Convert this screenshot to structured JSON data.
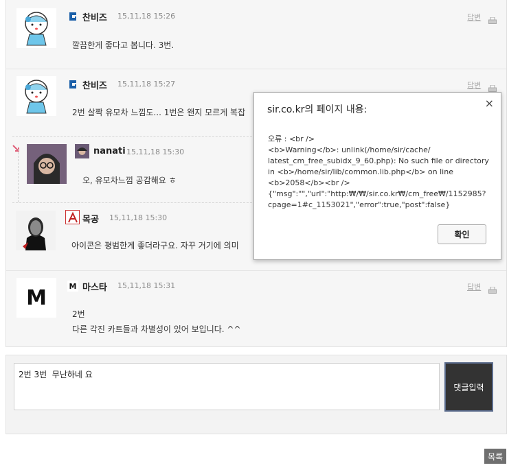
{
  "comments": [
    {
      "nick": "찬비즈",
      "date": "15,11,18 15:26",
      "reply_label": "답변",
      "lines": [
        "깔끔한게 좋다고 봅니다. 3번."
      ]
    },
    {
      "nick": "찬비즈",
      "date": "15,11,18 15:27",
      "reply_label": "답변",
      "lines": [
        "2번 살짝 유모차 느낌도... 1번은 왠지 모르게 복잡"
      ]
    },
    {
      "nick": "nanati",
      "date": "15,11,18 15:30",
      "lines": [
        "오, 유모차느낌 공감해요 ㅎ"
      ]
    },
    {
      "nick": "목공",
      "date": "15,11,18 15:30",
      "lines": [
        "아이콘은 평범한게 좋더라구요. 자꾸 거기에 의미"
      ]
    },
    {
      "nick": "마스타",
      "date": "15,11,18 15:31",
      "reply_label": "답변",
      "avatar_letter": "M",
      "level_letter": "M",
      "lines": [
        "2번",
        "다른 각진 카트들과 차별성이 있어 보입니다. ^^"
      ]
    }
  ],
  "compose": {
    "value": "2번 3번  무난하네 요",
    "submit_label": "댓글입력"
  },
  "list_button": "목록",
  "dialog": {
    "title": "sir.co.kr의 페이지 내용:",
    "close": "×",
    "message_lines": [
      "오류 : <br />",
      "<b>Warning</b>:  unlink(/home/sir/cache/",
      "latest_cm_free_subidx_9_60.php): No such file or directory",
      "in <b>/home/sir/lib/common.lib.php</b> on line",
      "<b>2058</b><br />",
      "{\"msg\":\"\",\"url\":\"http:₩/₩/sir.co.kr₩/cm_free₩/1152985?",
      "cpage=1#c_1153021\",\"error\":true,\"post\":false}"
    ],
    "ok_label": "확인"
  },
  "colors": {
    "board_bg": "#f6f6f6",
    "submit_bg": "#333333",
    "level_icon": "#1a5fa8"
  }
}
